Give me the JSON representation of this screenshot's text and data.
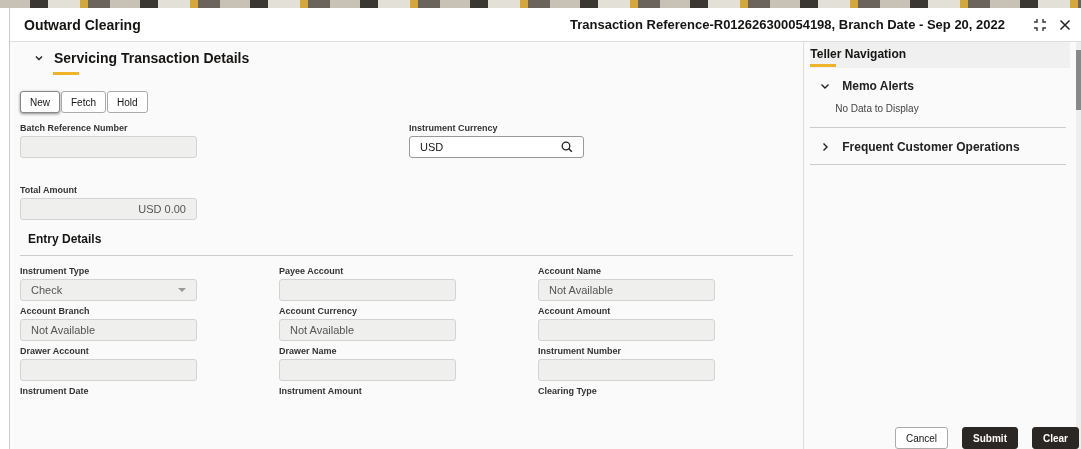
{
  "header": {
    "title": "Outward Clearing",
    "reference": "Transaction Reference-R012626300054198, Branch Date - Sep 20, 2022"
  },
  "section": {
    "title": "Servicing Transaction Details",
    "expanded": true
  },
  "action_buttons": [
    {
      "label": "New",
      "selected": true
    },
    {
      "label": "Fetch",
      "selected": false
    },
    {
      "label": "Hold",
      "selected": false
    }
  ],
  "top_fields": [
    {
      "label": "Batch Reference Number",
      "kind": "readonly"
    },
    {
      "label": "Instrument Currency",
      "kind": "search",
      "value": "USD"
    },
    {
      "label": "Total Amount",
      "kind": "amount",
      "value": "USD 0.00"
    }
  ],
  "entry_details": {
    "title": "Entry Details",
    "fields": [
      {
        "label": "Instrument Type",
        "kind": "select",
        "value": "Check"
      },
      {
        "label": "Payee Account",
        "kind": "readonly"
      },
      {
        "label": "Account Name",
        "kind": "readonly",
        "value": "Not Available"
      },
      {
        "label": "Account Branch",
        "kind": "readonly",
        "value": "Not Available"
      },
      {
        "label": "Account Currency",
        "kind": "readonly",
        "value": "Not Available"
      },
      {
        "label": "Account Amount",
        "kind": "readonly"
      },
      {
        "label": "Drawer Account",
        "kind": "readonly"
      },
      {
        "label": "Drawer Name",
        "kind": "readonly"
      },
      {
        "label": "Instrument Number",
        "kind": "readonly"
      },
      {
        "label": "Instrument Date",
        "kind": "hidden"
      },
      {
        "label": "Instrument Amount",
        "kind": "hidden"
      },
      {
        "label": "Clearing Type",
        "kind": "hidden"
      }
    ]
  },
  "sidebar": {
    "title": "Teller Navigation",
    "panels": [
      {
        "title": "Memo Alerts",
        "expanded": true,
        "content": "No Data to Display"
      },
      {
        "title": "Frequent Customer Operations",
        "expanded": false
      }
    ]
  },
  "footer_buttons": [
    {
      "label": "Cancel",
      "kind": "secondary"
    },
    {
      "label": "Submit",
      "kind": "primary"
    },
    {
      "label": "Clear",
      "kind": "primary"
    }
  ]
}
